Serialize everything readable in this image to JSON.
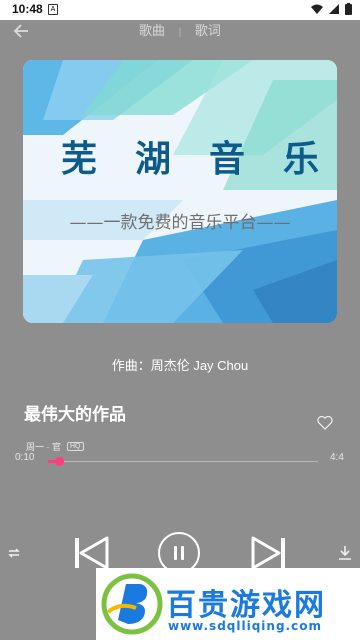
{
  "status_bar": {
    "time": "10:48",
    "notification_letter": "A"
  },
  "header": {
    "tabs": [
      {
        "label": "歌曲"
      },
      {
        "label": "歌词"
      }
    ],
    "separator": "|"
  },
  "cover": {
    "title": "芜湖音乐",
    "subtitle": "——一款免费的音乐平台——"
  },
  "track": {
    "composer": "作曲：周杰伦 Jay Chou",
    "title": "最伟大的作品",
    "artist": "周一 · 官",
    "quality_badge": "HQ"
  },
  "player": {
    "current_time": "0:10",
    "total_time": "4:4",
    "progress_fraction": 0.04
  },
  "watermark": {
    "text": "百贵游戏网",
    "url": "www.sdqlliqing.com"
  },
  "colors": {
    "accent": "#ff3d7f",
    "background": "#8e8e8e",
    "cover_title": "#0c5b8a",
    "watermark_blue": "#1a7ae0"
  }
}
